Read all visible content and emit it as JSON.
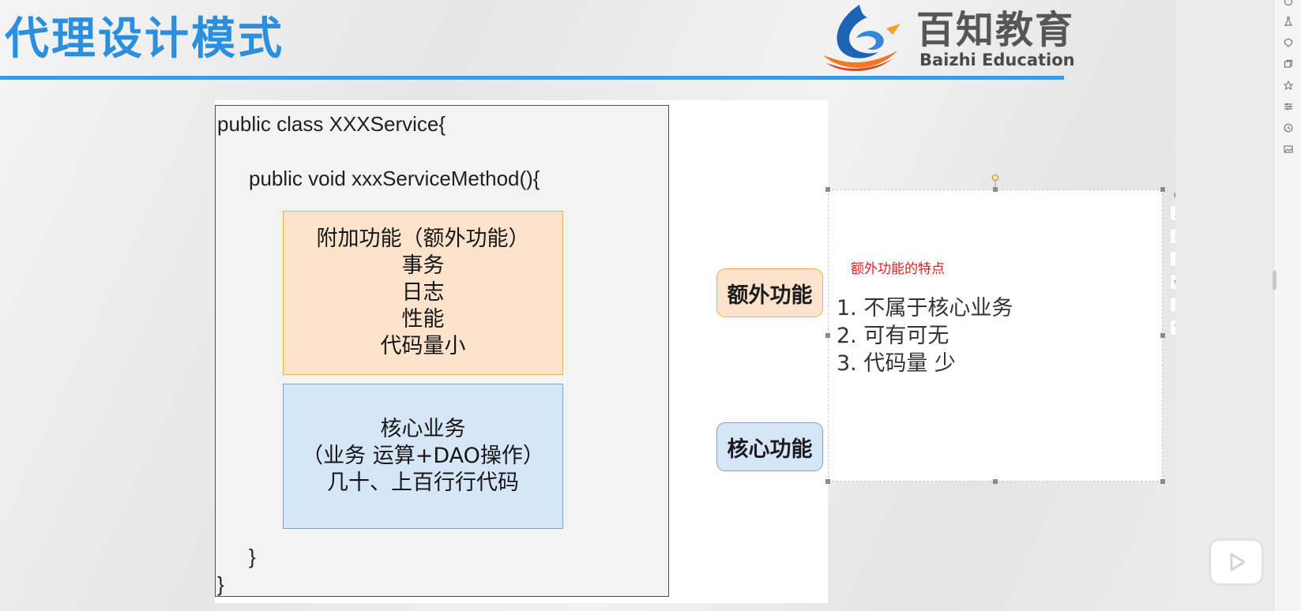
{
  "header": {
    "title": "代理设计模式",
    "logo_cn": "百知教育",
    "logo_en": "Baizhi Education"
  },
  "code": {
    "line1": "public class XXXService{",
    "line2": "public void xxxServiceMethod(){",
    "close_inner": "}",
    "close_outer": "}"
  },
  "extra_box": {
    "lines": [
      "附加功能（额外功能）",
      "事务",
      "日志",
      "性能",
      "代码量小"
    ]
  },
  "core_box": {
    "lines": [
      "核心业务",
      "（业务 运算+DAO操作）",
      "几十、上百行行代码"
    ]
  },
  "labels": {
    "extra": "额外功能",
    "core": "核心功能"
  },
  "note": {
    "title": "额外功能的特点",
    "items": [
      "1. 不属于核心业务",
      "2. 可有可无",
      "3. 代码量 少"
    ]
  },
  "mini_toolbar_icons": [
    "minus-circle-icon",
    "pencil-icon",
    "eraser-icon",
    "book-icon",
    "layers-icon",
    "text-style-icon",
    "crop-icon"
  ],
  "rail_icons": [
    "circle-icon",
    "flask-icon",
    "shield-icon",
    "copy-icon",
    "badge-icon",
    "sliders-icon",
    "history-icon",
    "image-icon"
  ],
  "colors": {
    "title_blue": "#2b8fe0",
    "extra_fill": "#fde3cb",
    "extra_border": "#ecb24f",
    "core_fill": "#d7e5f8",
    "core_border": "#7d9fd3",
    "note_title_red": "#e0201f"
  }
}
